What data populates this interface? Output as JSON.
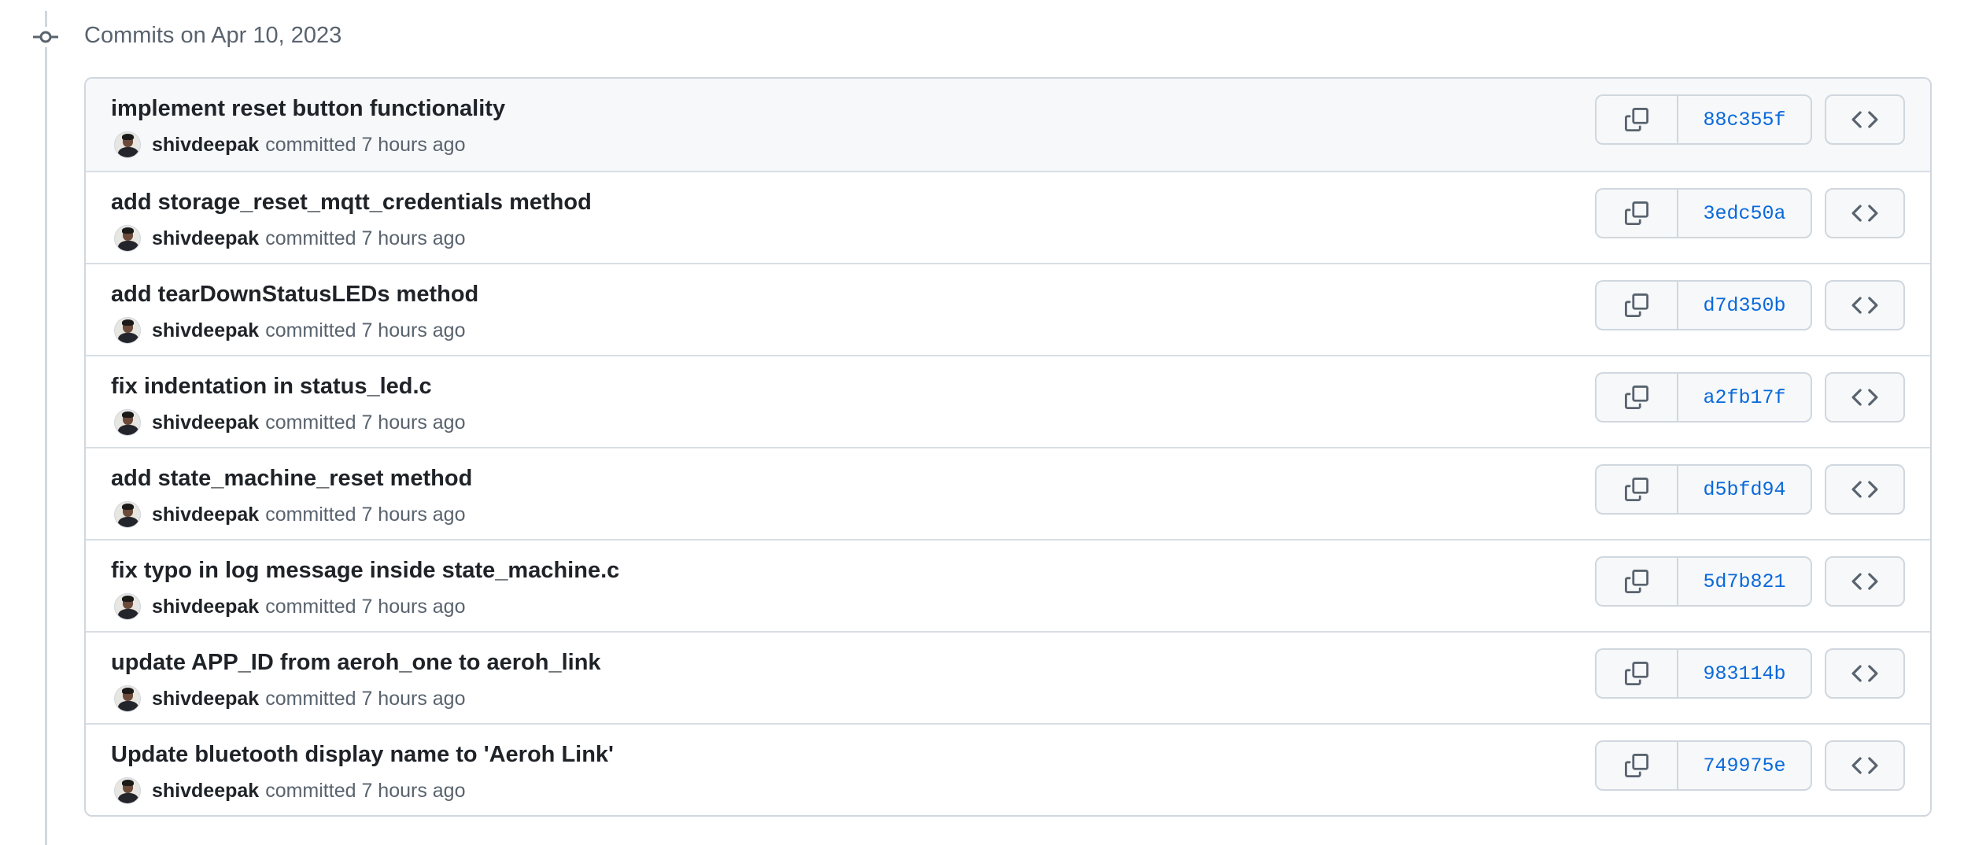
{
  "group": {
    "header": "Commits on Apr 10, 2023"
  },
  "commits": [
    {
      "title": "implement reset button functionality",
      "author": "shivdeepak",
      "meta": "committed 7 hours ago",
      "sha": "88c355f"
    },
    {
      "title": "add storage_reset_mqtt_credentials method",
      "author": "shivdeepak",
      "meta": "committed 7 hours ago",
      "sha": "3edc50a"
    },
    {
      "title": "add tearDownStatusLEDs method",
      "author": "shivdeepak",
      "meta": "committed 7 hours ago",
      "sha": "d7d350b"
    },
    {
      "title": "fix indentation in status_led.c",
      "author": "shivdeepak",
      "meta": "committed 7 hours ago",
      "sha": "a2fb17f"
    },
    {
      "title": "add state_machine_reset method",
      "author": "shivdeepak",
      "meta": "committed 7 hours ago",
      "sha": "d5bfd94"
    },
    {
      "title": "fix typo in log message inside state_machine.c",
      "author": "shivdeepak",
      "meta": "committed 7 hours ago",
      "sha": "5d7b821"
    },
    {
      "title": "update APP_ID from aeroh_one to aeroh_link",
      "author": "shivdeepak",
      "meta": "committed 7 hours ago",
      "sha": "983114b"
    },
    {
      "title": "Update bluetooth display name to 'Aeroh Link'",
      "author": "shivdeepak",
      "meta": "committed 7 hours ago",
      "sha": "749975e"
    }
  ],
  "icons": {
    "timeline": "git-commit-icon",
    "copy": "copy-icon",
    "browse": "code-icon",
    "avatar": "user-avatar"
  },
  "colors": {
    "link": "#0969da",
    "muted": "#59636e",
    "border": "#d0d7de",
    "header_row_bg": "#f6f8fa"
  }
}
